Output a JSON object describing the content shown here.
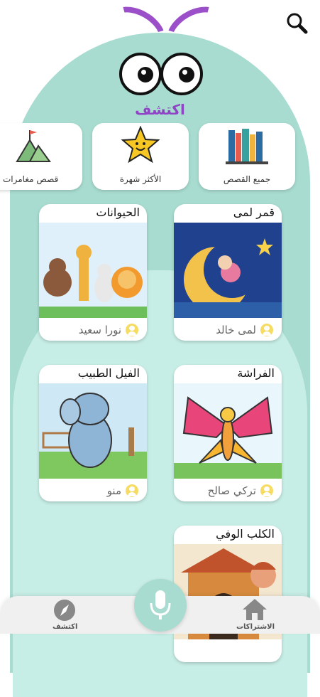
{
  "header": {
    "title": "اكتشف"
  },
  "categories": [
    {
      "label": "جميع القصص",
      "icon": "books-icon"
    },
    {
      "label": "الأكثر شهرة",
      "icon": "star-icon"
    },
    {
      "label": "قصص مغامرات",
      "icon": "mountain-icon"
    }
  ],
  "stories": [
    {
      "title": "قمر لمى",
      "author": "لمى خالد"
    },
    {
      "title": "الحيوانات",
      "author": "نورا سعيد"
    },
    {
      "title": "الفراشة",
      "author": "تركي صالح"
    },
    {
      "title": "الفيل الطبيب",
      "author": "منو"
    },
    {
      "title": "الكلب الوفي",
      "author": ""
    }
  ],
  "bottom_nav": {
    "discover_label": "اكتشف",
    "subscriptions_label": "الاشتراكات"
  },
  "colors": {
    "accent": "#8e44c4",
    "mascot": "#a8dcd0",
    "mascot_light": "#c7eee6"
  }
}
